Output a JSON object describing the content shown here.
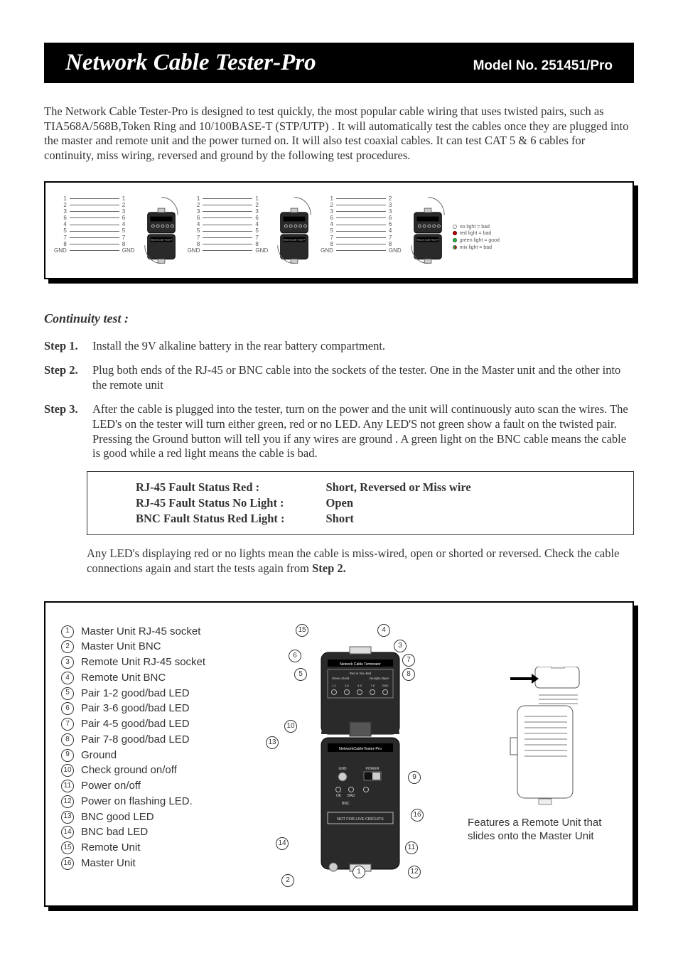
{
  "header": {
    "title": "Network Cable Tester-Pro",
    "model": "Model No. 251451/Pro"
  },
  "intro": "The Network Cable Tester-Pro is designed to test quickly, the most popular cable wiring that uses twisted pairs, such as TIA568A/568B,Token Ring and 10/100BASE-T (STP/UTP) . It will automatically test the cables once they are plugged into the master and remote unit and the power turned on. It will also test coaxial cables. It can test CAT 5 & 6 cables for continuity, miss wiring, reversed and ground by the following test procedures.",
  "wiring_maps": [
    {
      "left": [
        "1",
        "2",
        "3",
        "6",
        "4",
        "5",
        "7",
        "8",
        "GND"
      ],
      "right": [
        "1",
        "2",
        "3",
        "6",
        "4",
        "5",
        "7",
        "8",
        "GND"
      ]
    },
    {
      "left": [
        "1",
        "2",
        "3",
        "6",
        "4",
        "5",
        "7",
        "8",
        "GND"
      ],
      "right": [
        "1",
        "2",
        "3",
        "6",
        "4",
        "5",
        "7",
        "8",
        "GND"
      ]
    },
    {
      "left": [
        "1",
        "2",
        "3",
        "6",
        "4",
        "5",
        "7",
        "8",
        "GND"
      ],
      "right": [
        "2",
        "3",
        "3",
        "6",
        "6",
        "4",
        "7",
        "8",
        "GND"
      ]
    }
  ],
  "mini_legend": {
    "none": "no light = bad",
    "red": "red light = bad",
    "green": "green light = good",
    "mix": "mix light = bad"
  },
  "continuity": {
    "heading": "Continuity test :",
    "steps": [
      {
        "label": "Step 1.",
        "body": "Install the 9V alkaline battery in the rear battery compartment."
      },
      {
        "label": "Step 2.",
        "body": "Plug both ends of the RJ-45 or BNC cable into the sockets of the tester. One in the Master unit and the other into the remote unit"
      },
      {
        "label": "Step 3.",
        "body": "After the cable is plugged into the tester, turn on the power and the unit will continuously auto scan the wires. The LED's on the tester will turn either green, red or no LED. Any LED'S not green show a fault on the twisted pair. Pressing the Ground button will tell you if any wires are ground . A green light on the BNC cable means the cable is good while a red light means the cable is bad."
      }
    ],
    "fault_table": [
      {
        "k": "RJ-45 Fault Status Red :",
        "v": "Short, Reversed or Miss wire"
      },
      {
        "k": "RJ-45 Fault Status No Light :",
        "v": "Open"
      },
      {
        "k": "BNC   Fault Status Red Light :",
        "v": "Short"
      }
    ],
    "post_fault_prefix": "Any LED's displaying red or no lights mean the cable is miss-wired, open or shorted or reversed. Check the cable connections again and start the tests again from ",
    "post_fault_bold": "Step 2."
  },
  "parts": [
    "Master Unit  RJ-45  socket",
    "Master Unit  BNC",
    "Remote Unit  RJ-45  socket",
    "Remote Unit BNC",
    "Pair 1-2  good/bad LED",
    "Pair 3-6  good/bad LED",
    "Pair 4-5  good/bad LED",
    "Pair 7-8  good/bad LED",
    "Ground",
    "Check ground on/off",
    "Power on/off",
    "Power on flashing LED.",
    "BNC good LED",
    "BNC bad LED",
    "Remote Unit",
    "Master Unit"
  ],
  "device_labels": {
    "remote_title": "Network Cable Terminator",
    "remote_legend_l1": "Red or mix=Bad",
    "remote_legend_l2_left": "Green=Good",
    "remote_legend_l2_right": "No  light=Open",
    "pairs": [
      "1-2",
      "3-6",
      "4-5",
      "7-8",
      "GND"
    ],
    "master_title": "NetworkCableTester-Pro",
    "gnd": "GND",
    "power": "POWER",
    "ok": "OK",
    "bad": "BAD",
    "bnc": "BNC",
    "warn": "NOT FOR LIVE CIRCUITS"
  },
  "right_caption": "Features a Remote Unit that slides onto the Master Unit"
}
